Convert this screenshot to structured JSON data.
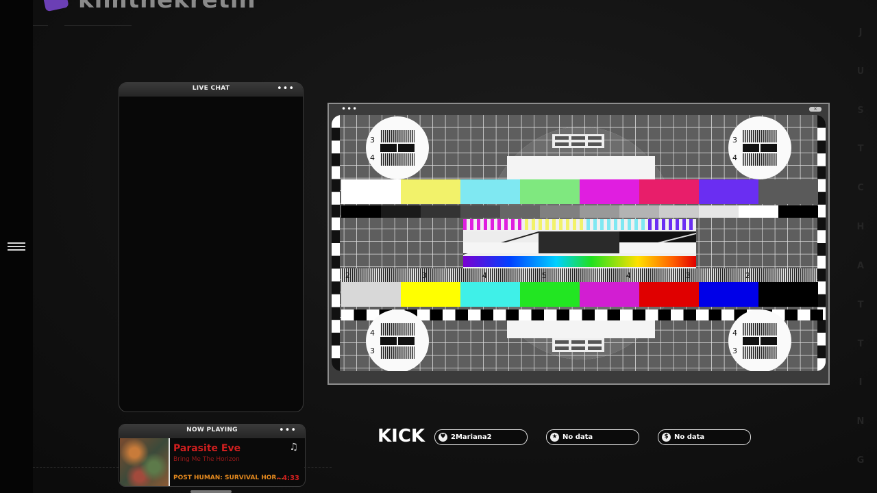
{
  "header": {
    "channel_name": "kimthekretin",
    "logo_icon": "kick-channel-logo-icon"
  },
  "sidebar": {
    "menu_icon": "hamburger-menu-icon"
  },
  "side_letters": [
    "J",
    "U",
    "S",
    "T",
    "C",
    "H",
    "A",
    "T",
    "T",
    "I",
    "N",
    "G"
  ],
  "chat": {
    "title": "LIVE CHAT",
    "menu_icon": "more-dots-icon"
  },
  "video": {
    "menu_icon": "more-dots-icon",
    "close_label": "×",
    "testcard_digits": [
      "3",
      "4",
      "3",
      "4",
      "4",
      "3",
      "4",
      "3"
    ],
    "ruler_digits": [
      "2",
      "3",
      "4",
      "5",
      "4",
      "3",
      "2"
    ]
  },
  "now_playing": {
    "title": "NOW PLAYING",
    "menu_icon": "more-dots-icon",
    "track": "Parasite Eve",
    "artist": "Bring Me The Horizon",
    "album": "POST HUMAN: SURVIVAL HOR...",
    "time": "- 4:33",
    "note_icon": "music-note-icon"
  },
  "stats": {
    "platform": "KICK",
    "items": [
      {
        "icon": "heart-icon",
        "glyph": "♥",
        "label": "2Mariana2"
      },
      {
        "icon": "star-icon",
        "glyph": "★",
        "label": "No data"
      },
      {
        "icon": "dollar-icon",
        "glyph": "$",
        "label": "No data"
      }
    ]
  },
  "colors": {
    "accent": "#6b3fb5",
    "track_red": "#d21f1f",
    "album_orange": "#e58a1f",
    "bars_top": [
      "#ffffff",
      "#f2f26a",
      "#7fe8f2",
      "#7fe87f",
      "#e01ee0",
      "#e81e6a",
      "#6a2ef2",
      "#5a5a5a"
    ],
    "bars_bottom": [
      "#d8d8d8",
      "#ffff00",
      "#3ff0e8",
      "#22e622",
      "#d21ed2",
      "#e00000",
      "#0000e8",
      "#000000"
    ]
  }
}
